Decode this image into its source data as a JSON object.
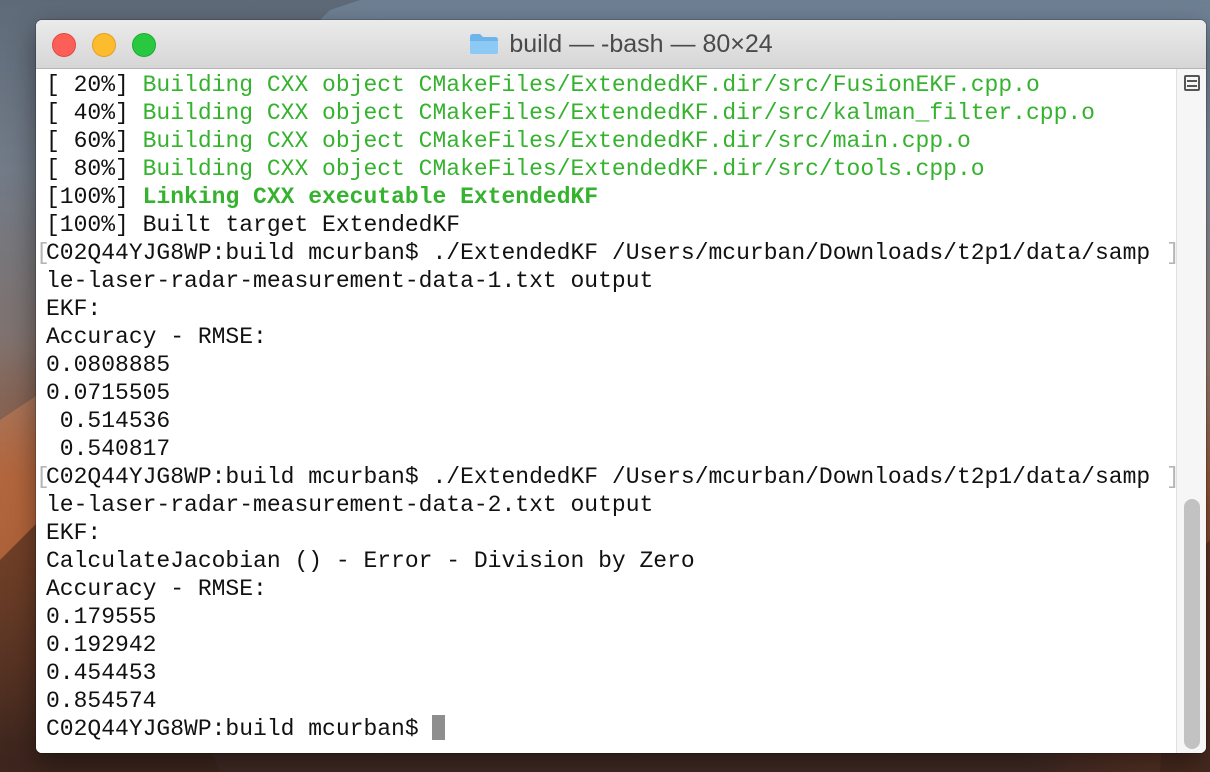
{
  "window": {
    "title": "build — -bash — 80×24",
    "folder_icon": "folder-icon"
  },
  "terminal": {
    "lines": [
      {
        "prefix": "[ 20%] ",
        "text": "Building CXX object CMakeFiles/ExtendedKF.dir/src/FusionEKF.cpp.o",
        "style": "green"
      },
      {
        "prefix": "[ 40%] ",
        "text": "Building CXX object CMakeFiles/ExtendedKF.dir/src/kalman_filter.cpp.o",
        "style": "green"
      },
      {
        "prefix": "[ 60%] ",
        "text": "Building CXX object CMakeFiles/ExtendedKF.dir/src/main.cpp.o",
        "style": "green"
      },
      {
        "prefix": "[ 80%] ",
        "text": "Building CXX object CMakeFiles/ExtendedKF.dir/src/tools.cpp.o",
        "style": "green"
      },
      {
        "prefix": "[100%] ",
        "text": "Linking CXX executable ExtendedKF",
        "style": "green-bold"
      },
      {
        "prefix": "[100%] ",
        "text": "Built target ExtendedKF",
        "style": "plain"
      },
      {
        "prefix": "",
        "text": "C02Q44YJG8WP:build mcurban$ ./ExtendedKF /Users/mcurban/Downloads/t2p1/data/samp",
        "style": "plain",
        "marked": true
      },
      {
        "prefix": "",
        "text": "le-laser-radar-measurement-data-1.txt output",
        "style": "plain"
      },
      {
        "prefix": "",
        "text": "EKF:",
        "style": "plain"
      },
      {
        "prefix": "",
        "text": "Accuracy - RMSE:",
        "style": "plain"
      },
      {
        "prefix": "",
        "text": "0.0808885",
        "style": "plain"
      },
      {
        "prefix": "",
        "text": "0.0715505",
        "style": "plain"
      },
      {
        "prefix": "",
        "text": " 0.514536",
        "style": "plain"
      },
      {
        "prefix": "",
        "text": " 0.540817",
        "style": "plain"
      },
      {
        "prefix": "",
        "text": "C02Q44YJG8WP:build mcurban$ ./ExtendedKF /Users/mcurban/Downloads/t2p1/data/samp",
        "style": "plain",
        "marked": true
      },
      {
        "prefix": "",
        "text": "le-laser-radar-measurement-data-2.txt output",
        "style": "plain"
      },
      {
        "prefix": "",
        "text": "EKF:",
        "style": "plain"
      },
      {
        "prefix": "",
        "text": "CalculateJacobian () - Error - Division by Zero",
        "style": "plain"
      },
      {
        "prefix": "",
        "text": "Accuracy - RMSE:",
        "style": "plain"
      },
      {
        "prefix": "",
        "text": "0.179555",
        "style": "plain"
      },
      {
        "prefix": "",
        "text": "0.192942",
        "style": "plain"
      },
      {
        "prefix": "",
        "text": "0.454453",
        "style": "plain"
      },
      {
        "prefix": "",
        "text": "0.854574",
        "style": "plain"
      },
      {
        "prefix": "",
        "text": "C02Q44YJG8WP:build mcurban$ ",
        "style": "plain",
        "cursor": true
      }
    ],
    "mark_left": "[",
    "mark_right": "]"
  },
  "colors": {
    "build_output_green": "#35b22e",
    "cursor": "#8e8e8e"
  },
  "scrollbar": {
    "split_icon": "split-pane-icon"
  }
}
